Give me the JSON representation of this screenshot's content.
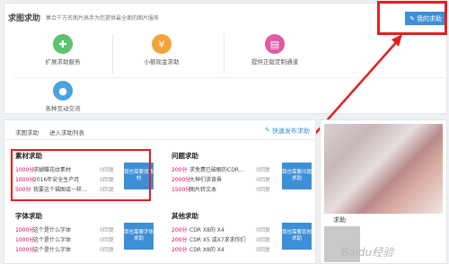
{
  "header": {
    "title": "求图求助",
    "subtitle": "集合千万名图片高手为您提供最全面的图片服务",
    "my_help_button": "我的求助"
  },
  "services": [
    {
      "label": "扩展求助服务",
      "icon": "puzzle-icon",
      "color": "#5cc36e"
    },
    {
      "label": "小额现金求助",
      "icon": "yen-icon",
      "color": "#f2a33a"
    },
    {
      "label": "提供正版定制通道",
      "icon": "clipboard-icon",
      "color": "#e15aa4"
    },
    {
      "label": "各种互动交流",
      "icon": "chat-icon",
      "color": "#4aa3df"
    }
  ],
  "list": {
    "title": "求图求助",
    "link": "进入求助列表",
    "quick_post": "快速发布求助"
  },
  "categories": [
    {
      "title": "素材求助",
      "rows": [
        {
          "points": "1000分",
          "question": "求蝴蝶花纹素材",
          "replies": "0回复"
        },
        {
          "points": "1000分",
          "question": "2016年安全生产月",
          "replies": "0回复"
        },
        {
          "points": "500分",
          "question": "我要这个福图或一样…",
          "replies": "0回复"
        }
      ],
      "button": "我也需要找素材"
    },
    {
      "title": "问题求助",
      "rows": [
        {
          "points": "200分",
          "question": "求免费已破解的CDR…",
          "replies": "0回复"
        },
        {
          "points": "2000分",
          "question": "大神们求背景",
          "replies": "0回复"
        },
        {
          "points": "1500分",
          "question": "图片转文本",
          "replies": "0回复"
        }
      ],
      "button": "我也需要问题求助"
    },
    {
      "title": "字体求助",
      "rows": [
        {
          "points": "1000分",
          "question": "这个是什么字体",
          "replies": "0回复"
        },
        {
          "points": "1000分",
          "question": "这个是什么字体",
          "replies": "0回复"
        },
        {
          "points": "1000分",
          "question": "这个是什么字体",
          "replies": "0回复"
        }
      ],
      "button": "我也需要字体求助"
    },
    {
      "title": "其他求助",
      "rows": [
        {
          "points": "200分",
          "question": "CDR X8的 X4",
          "replies": "0回复"
        },
        {
          "points": "200分",
          "question": "CDR X5 或X7求求你们",
          "replies": "0回复"
        },
        {
          "points": "200分",
          "question": "CDR X8的 X4",
          "replies": "0回复"
        }
      ],
      "button": "我也需要其他求助"
    }
  ],
  "side": {
    "label": "求助"
  },
  "watermark": "Baidu经验",
  "colors": {
    "accent": "#3d8fd8",
    "points": "#e0006a",
    "annotation": "#e02020"
  }
}
